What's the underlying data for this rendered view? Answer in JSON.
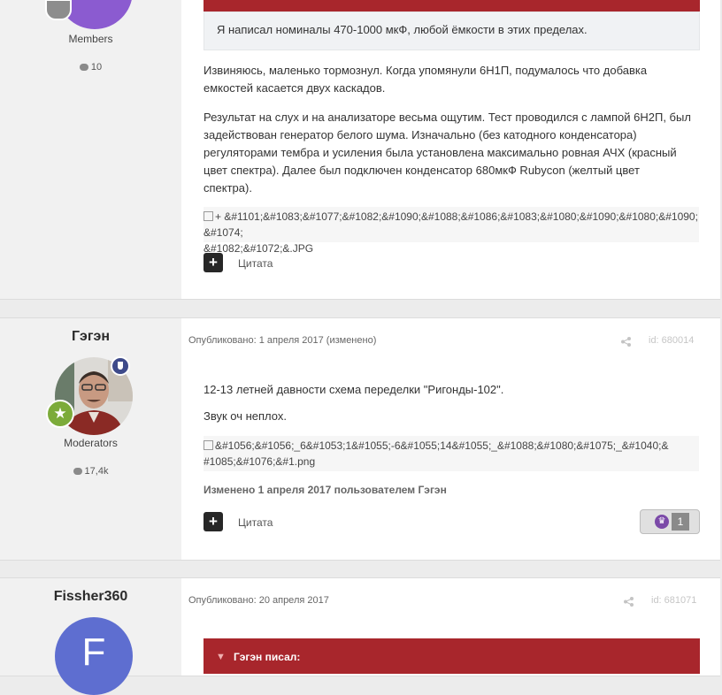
{
  "post1": {
    "author_group": "Members",
    "author_posts": "10",
    "quote_text": "Я написал номиналы 470-1000 мкФ, любой ёмкости в этих пределах.",
    "paragraph1_line1": "Извиняюсь, маленько тормознул. Когда упомянули 6Н1П, подумалось что добавка",
    "paragraph1_line2": "емкостей касается двух каскадов.",
    "paragraph2_lines": [
      "Результат на слух и на анализаторе весьма ощутим. Тест проводился с лампой 6Н2П, был",
      "задействован генератор белого шума. Изначально (без катодного конденсатора)",
      "регуляторами тембра и усиления была установлена максимально ровная АЧХ (красный",
      "цвет спектра). Далее был подключен конденсатор 680мкФ Rubycon (желтый цвет",
      "спектра)."
    ],
    "image_alt_line1": "+ &#1101;&#1083;&#1077;&#1082;&#1090;&#1088;&#1086;&#1083;&#1080;&#1090;&#1080;&#1090; &#1074;",
    "image_alt_line2": "&#1082;&#1072;&.JPG",
    "quote_button": "Цитата"
  },
  "post2": {
    "author_name": "Гэгэн",
    "author_group": "Moderators",
    "author_posts": "17,4k",
    "date": "Опубликовано: 1 апреля 2017 (изменено)",
    "post_id": "id: 680014",
    "line1": "12-13 летней давности схема переделки \"Ригонды-102\".",
    "line2": "Звук оч неплох.",
    "image_alt_line1": "&#1056;&#1056;_6&#1053;1&#1055;-6&#1055;14&#1055;_&#1088;&#1080;&#1075;_&#1040;&",
    "image_alt_line2": "#1085;&#1076;&#1.png",
    "edited_note": "Изменено 1 апреля 2017 пользователем Гэгэн",
    "quote_button": "Цитата",
    "reaction_count": "1"
  },
  "post3": {
    "author_name": "Fissher360",
    "avatar_letter": "F",
    "date": "Опубликовано: 20 апреля 2017",
    "post_id": "id: 681071",
    "quote_header": "Гэгэн писал:"
  },
  "colors": {
    "accent_red": "#a8262c",
    "avatar_purple": "#8b5bd0",
    "avatar_blue": "#5e6ed0"
  },
  "icons": [
    "plus-icon",
    "share-icon",
    "speech-bubble-icon",
    "trophy-icon",
    "star-badge-icon",
    "shield-icon"
  ]
}
